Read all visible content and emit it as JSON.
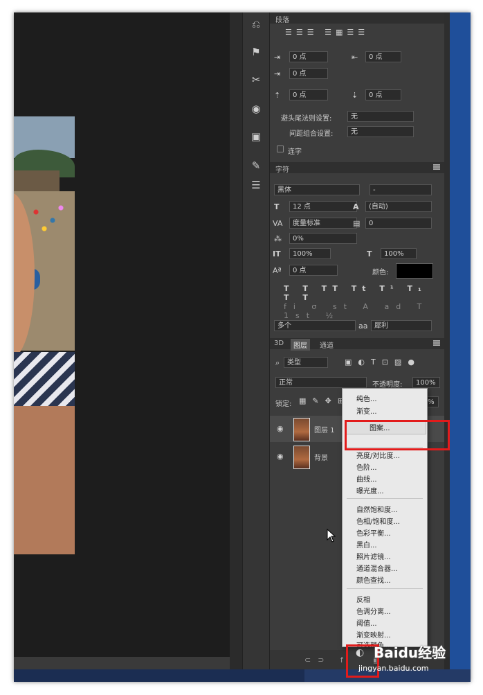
{
  "paragraph_panel": {
    "title": "段落",
    "indent_left": "0 点",
    "indent_right": "0 点",
    "first_line_indent": "0 点",
    "space_before": "0 点",
    "space_after": "0 点",
    "kinsoku_label": "避头尾法则设置:",
    "kinsoku_value": "无",
    "mojikumi_label": "间距组合设置:",
    "mojikumi_value": "无",
    "hyphenate_label": "连字"
  },
  "character_panel": {
    "title": "字符",
    "font_family": "黑体",
    "font_style": "-",
    "font_size": "12 点",
    "leading": "(自动)",
    "kerning": "度量标准",
    "tracking": "0",
    "tsume": "0%",
    "vertical_scale": "100%",
    "horizontal_scale": "100%",
    "baseline_shift": "0 点",
    "color_label": "颜色:",
    "color_value": "#000000",
    "language": "多个",
    "antialias": "犀利"
  },
  "layers_panel": {
    "tabs": [
      "3D",
      "图层",
      "通道"
    ],
    "active_tab": "图层",
    "filter_kind": "类型",
    "blend_mode": "正常",
    "opacity_label": "不透明度:",
    "opacity_value": "100%",
    "lock_label": "锁定:",
    "fill_value": "100%",
    "layers": [
      {
        "name": "图层 1"
      },
      {
        "name": "背景"
      }
    ]
  },
  "adjustment_menu": {
    "items_group1": [
      "纯色...",
      "渐变...",
      "图案..."
    ],
    "highlighted": "图案...",
    "items_group2": [
      "亮度/对比度...",
      "色阶...",
      "曲线...",
      "曝光度..."
    ],
    "items_group3": [
      "自然饱和度...",
      "色相/饱和度...",
      "色彩平衡...",
      "黑白...",
      "照片滤镜...",
      "通道混合器...",
      "颜色查找..."
    ],
    "items_group4": [
      "反相",
      "色调分离...",
      "阈值...",
      "渐变映射...",
      "可选颜色..."
    ]
  },
  "watermark": {
    "logo": "Baidu经验",
    "url": "jingyan.baidu.com"
  },
  "colors": {
    "highlight_box": "#e21b1b",
    "panel_bg": "#3c3c3c",
    "canvas_bg": "#1d1d1d"
  }
}
